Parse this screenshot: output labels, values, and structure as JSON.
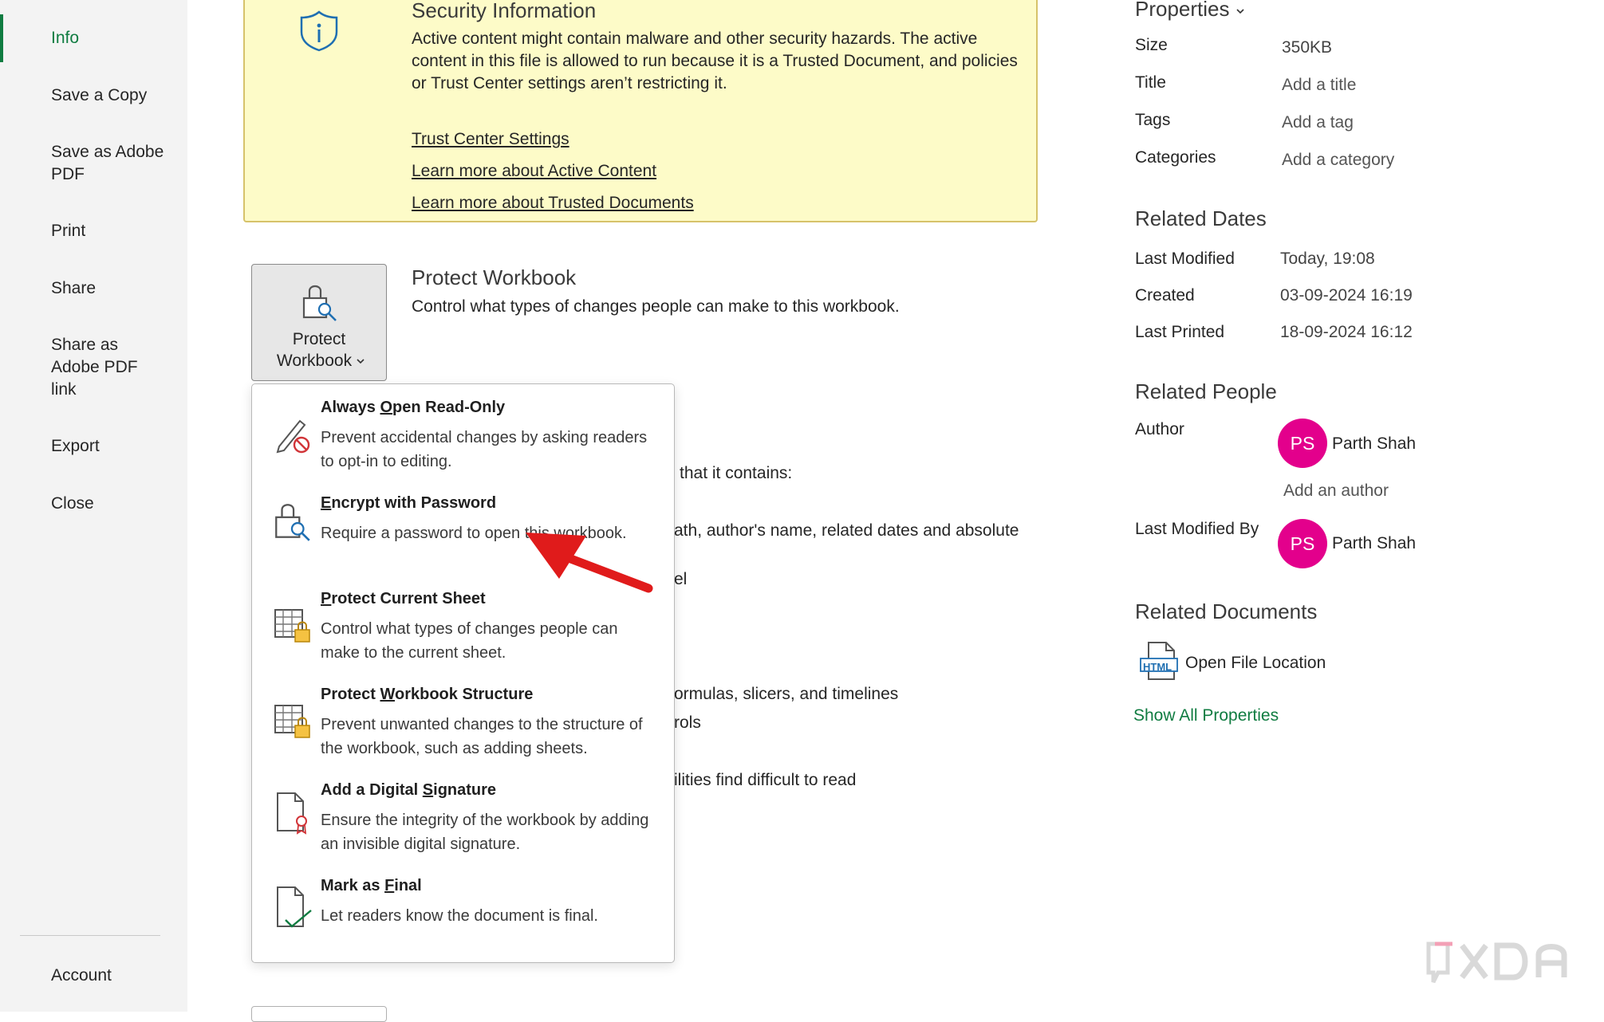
{
  "nav": {
    "items": [
      {
        "label": "Info"
      },
      {
        "label": "Save a Copy"
      },
      {
        "label": "Save as Adobe PDF"
      },
      {
        "label": "Print"
      },
      {
        "label": "Share"
      },
      {
        "label": "Share as Adobe PDF link"
      },
      {
        "label": "Export"
      },
      {
        "label": "Close"
      }
    ],
    "account_label": "Account"
  },
  "security": {
    "title": "Security Information",
    "body": "Active content might contain malware and other security hazards. The active content in this file is allowed to run because it is a Trusted Document, and policies or Trust Center settings aren’t restricting it.",
    "links": [
      "Trust Center Settings",
      "Learn more about Active Content",
      "Learn more about Trusted Documents"
    ]
  },
  "protect": {
    "button_line1": "Protect",
    "button_line2": "Workbook",
    "title": "Protect Workbook",
    "description": "Control what types of changes people can make to this workbook."
  },
  "background_text": {
    "t1": "that it contains:",
    "t2": "ath, author's name, related dates and absolute",
    "t3": "el",
    "t4": "ormulas, slicers, and timelines",
    "t5": "rols",
    "t6": "ilities find difficult to read"
  },
  "menu": {
    "items": [
      {
        "title_pre": "Always ",
        "title_u": "O",
        "title_post": "pen Read-Only",
        "desc": "Prevent accidental changes by asking readers to opt-in to editing."
      },
      {
        "title_pre": "",
        "title_u": "E",
        "title_post": "ncrypt with Password",
        "desc": "Require a password to open this workbook."
      },
      {
        "title_pre": "",
        "title_u": "P",
        "title_post": "rotect Current Sheet",
        "desc": "Control what types of changes people can make to the current sheet."
      },
      {
        "title_pre": "Protect ",
        "title_u": "W",
        "title_post": "orkbook Structure",
        "desc": "Prevent unwanted changes to the structure of the workbook, such as adding sheets."
      },
      {
        "title_pre": "Add a Digital ",
        "title_u": "S",
        "title_post": "ignature",
        "desc": "Ensure the integrity of the workbook by adding an invisible digital signature."
      },
      {
        "title_pre": "Mark as ",
        "title_u": "F",
        "title_post": "inal",
        "desc": "Let readers know the document is final."
      }
    ]
  },
  "properties": {
    "heading": "Properties",
    "size_label": "Size",
    "size_value": "350KB",
    "title_label": "Title",
    "title_value": "Add a title",
    "tags_label": "Tags",
    "tags_value": "Add a tag",
    "categories_label": "Categories",
    "categories_value": "Add a category"
  },
  "related_dates": {
    "heading": "Related Dates",
    "last_modified_label": "Last Modified",
    "last_modified_value": "Today, 19:08",
    "created_label": "Created",
    "created_value": "03-09-2024 16:19",
    "last_printed_label": "Last Printed",
    "last_printed_value": "18-09-2024 16:12"
  },
  "related_people": {
    "heading": "Related People",
    "author_label": "Author",
    "author_initials": "PS",
    "author_name": "Parth Shah",
    "add_author": "Add an author",
    "last_modified_by_label": "Last Modified By",
    "modifier_initials": "PS",
    "modifier_name": "Parth Shah"
  },
  "related_documents": {
    "heading": "Related Documents",
    "html_icon_text": "HTML",
    "open_location": "Open File Location",
    "show_all": "Show All Properties"
  },
  "colors": {
    "accent": "#107c41",
    "avatar": "#e3008c",
    "security_bg": "#fdfbc8",
    "arrow": "#e01b1b"
  }
}
